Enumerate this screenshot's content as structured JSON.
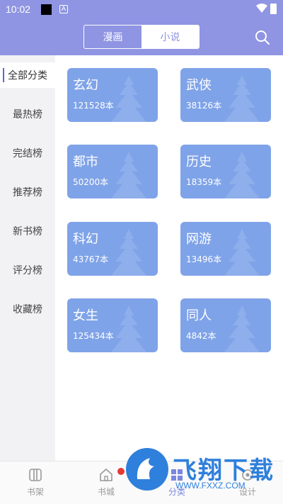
{
  "status_bar": {
    "time": "10:02",
    "badge": "A"
  },
  "header": {
    "tabs": [
      {
        "label": "漫画",
        "active": false
      },
      {
        "label": "小说",
        "active": true
      }
    ],
    "search_icon": "search-icon"
  },
  "sidebar": {
    "items": [
      {
        "label": "全部分类",
        "active": true
      },
      {
        "label": "最热榜"
      },
      {
        "label": "完结榜"
      },
      {
        "label": "推荐榜"
      },
      {
        "label": "新书榜"
      },
      {
        "label": "评分榜"
      },
      {
        "label": "收藏榜"
      }
    ]
  },
  "categories": [
    {
      "name": "玄幻",
      "count": "121528本"
    },
    {
      "name": "武侠",
      "count": "38126本"
    },
    {
      "name": "都市",
      "count": "50200本"
    },
    {
      "name": "历史",
      "count": "18359本"
    },
    {
      "name": "科幻",
      "count": "43767本"
    },
    {
      "name": "网游",
      "count": "13496本"
    },
    {
      "name": "女生",
      "count": "125434本"
    },
    {
      "name": "同人",
      "count": "4842本"
    }
  ],
  "bottom_tabs": [
    {
      "label": "书架",
      "icon": "bookshelf-icon"
    },
    {
      "label": "书城",
      "icon": "bookstore-icon"
    },
    {
      "label": "分类",
      "icon": "category-icon",
      "active": true
    },
    {
      "label": "设计",
      "icon": "settings-icon"
    }
  ],
  "watermark": {
    "text": "飞翔下载",
    "url": "WWW.FXXZ.COM"
  },
  "colors": {
    "header": "#8f95e2",
    "card": "#7fa3e8",
    "accent": "#5b67d8",
    "badge": "#e53935"
  }
}
